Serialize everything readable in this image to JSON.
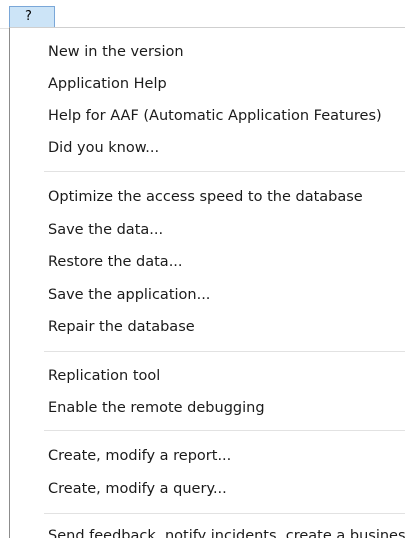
{
  "menubar": {
    "title": "?"
  },
  "menu": {
    "groups": [
      [
        "New in the version",
        "Application Help",
        "Help for AAF (Automatic Application Features)",
        "Did you know..."
      ],
      [
        "Optimize the access speed to the database",
        "Save the data...",
        "Restore the data...",
        "Save the application...",
        "Repair the database"
      ],
      [
        "Replication tool",
        "Enable the remote debugging"
      ],
      [
        "Create, modify a report...",
        "Create, modify a query..."
      ],
      [
        "Send feedback, notify incidents, create a business r"
      ]
    ]
  }
}
